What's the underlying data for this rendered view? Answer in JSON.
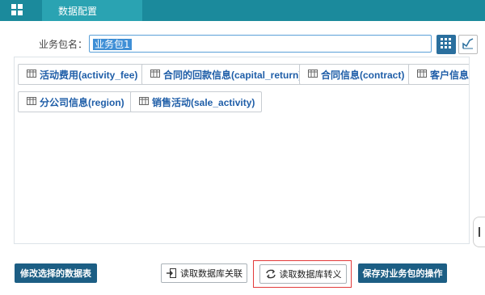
{
  "topbar": {
    "menu_icon": "grid-menu-icon",
    "tab_label": "数据配置",
    "colors": {
      "bar": "#1b8a9c",
      "tab": "#2aa3b2"
    }
  },
  "package": {
    "label": "业务包名：",
    "value": "业务包1",
    "view_grid_icon": "grid-view-icon",
    "view_chart_icon": "chart-view-icon"
  },
  "tables": [
    {
      "label": "活动费用(activity_fee)"
    },
    {
      "label": "合同的回款信息(capital_return)"
    },
    {
      "label": "合同信息(contract)"
    },
    {
      "label": "客户信息("
    },
    {
      "label": "分公司信息(region)"
    },
    {
      "label": "销售活动(sale_activity)"
    }
  ],
  "footer": {
    "modify_label": "修改选择的数据表",
    "read_relation_label": "读取数据库关联",
    "read_convert_label": "读取数据库转义",
    "save_label": "保存对业务包的操作"
  },
  "colors": {
    "accent_dark": "#1c5e84",
    "link_text": "#1f5ea8",
    "highlight": "#e23a3a"
  }
}
